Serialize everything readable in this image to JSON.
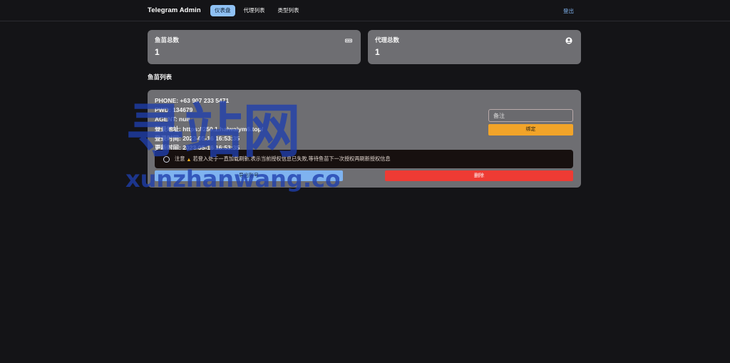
{
  "header": {
    "brand": "Telegram Admin",
    "nav": [
      {
        "label": "仪表盘",
        "active": true
      },
      {
        "label": "代理列表",
        "active": false
      },
      {
        "label": "类型列表",
        "active": false
      }
    ],
    "logout_label": "登出"
  },
  "stats": [
    {
      "label": "鱼苗总数",
      "value": "1",
      "icon": "gtm-badge-icon"
    },
    {
      "label": "代理总数",
      "value": "1",
      "icon": "user-circle-icon"
    }
  ],
  "fish_list": {
    "title": "鱼苗列表",
    "items": [
      {
        "phone": "PHONE: +63 907 233 5471",
        "pwd": "PWD: 134679",
        "agent": "AGENT: null",
        "login_url": "登录地址: https://250.1.haiwaiym6.top/",
        "login_time": "登录时间: 2023-05-16 16:53:35",
        "update_time": "更新时间: 2023-05-16 16:53:35",
        "remark_placeholder": "备注",
        "bind_label": "绑定",
        "notice_prefix": "注意",
        "notice_text": "若登入处于一直加载刷新,表示当前授权信息已失败,等待鱼苗下一次授权再刷新授权信息",
        "export_label": "导出账号",
        "delete_label": "删除"
      }
    ]
  },
  "watermark": {
    "text": "寻站网",
    "subtext": "xunzhanwang.com"
  },
  "colors": {
    "background": "#141417",
    "card": "#6e6e72",
    "accent_blue": "#7fb3f0",
    "warning": "#f2a429",
    "danger": "#ee3b34",
    "watermark": "#1f3fae"
  }
}
